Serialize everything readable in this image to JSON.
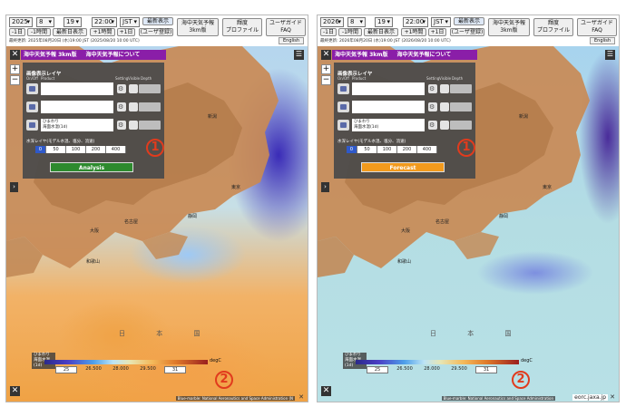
{
  "panels": [
    {
      "id": "left",
      "toolbar": {
        "year": "2025",
        "month": "8",
        "day": "19",
        "hour": "22:00",
        "tz": "JST",
        "latest_label": "最新表示",
        "back_day": "-1日",
        "back_hour": "-1時間",
        "latest_day": "最新日表示",
        "fwd_hour": "+1時間",
        "fwd_day": "+1日",
        "user_reg": "(ユーザ登録)",
        "forecast_title_1": "海中天気予報",
        "forecast_title_2": "3km版",
        "bright_1": "輝度",
        "bright_2": "プロファイル",
        "guide_1": "ユーザガイド",
        "guide_2": "FAQ",
        "info": "最終更新: 2025年08月20日 (水)19:00 JST (2025/08/20 10:00 UTC)",
        "english": "English"
      },
      "header": {
        "title": "海中天気予報 3km版",
        "link": "海中天気予報について"
      },
      "layer_panel": {
        "title": "画像表示レイヤ",
        "cols": [
          "On/Off",
          "Product",
          "Setting",
          "Visible",
          "Depth"
        ],
        "rows": [
          {
            "label": ""
          },
          {
            "label": ""
          },
          {
            "label": "ひまわり\n海面水温(1d)"
          }
        ],
        "depth_title": "水深レイヤ(モデル水温、塩分、流速)",
        "depths": [
          "0",
          "50",
          "100",
          "200",
          "400"
        ],
        "mode_button": "Analysis"
      },
      "circle_1": "1",
      "circle_2": "2",
      "places": {
        "niigata": "新潟",
        "tokyo": "東京",
        "osaka": "大阪",
        "nagoya": "名古屋",
        "shizuoka": "静岡",
        "wakayama": "和歌山"
      },
      "sea_label": "日 本 国",
      "legend": {
        "title": "ひまわり\n海面水温(1d)",
        "unit": "degC",
        "ticks": [
          "25",
          "26.500",
          "28.000",
          "29.500",
          "31"
        ]
      },
      "attrib": "Blue-marble: National Aeronautics and Space Administration (N",
      "close": "✕"
    },
    {
      "id": "right",
      "toolbar": {
        "year": "2026",
        "month": "8",
        "day": "19",
        "hour": "22:00",
        "tz": "JST",
        "latest_label": "最新表示",
        "back_day": "-1日",
        "back_hour": "-1時間",
        "latest_day": "最新日表示",
        "fwd_hour": "+1時間",
        "fwd_day": "+1日",
        "user_reg": "(ユーザ登録)",
        "forecast_title_1": "海中天気予報",
        "forecast_title_2": "3km版",
        "bright_1": "輝度",
        "bright_2": "プロファイル",
        "guide_1": "ユーザガイド",
        "guide_2": "FAQ",
        "info": "最終更新: 2026年08月20日 (水)19:00 JST (2026/08/20 10:00 UTC)",
        "english": "English"
      },
      "header": {
        "title": "海中天気予報 3km版",
        "link": "海中天気予報について"
      },
      "layer_panel": {
        "title": "画像表示レイヤ",
        "cols": [
          "On/Off",
          "Product",
          "Setting",
          "Visible",
          "Depth"
        ],
        "rows": [
          {
            "label": ""
          },
          {
            "label": ""
          },
          {
            "label": "ひまわり\n海面水温(1d)"
          }
        ],
        "depth_title": "水深レイヤ(モデル水温、塩分、流速)",
        "depths": [
          "0",
          "50",
          "100",
          "200",
          "400"
        ],
        "mode_button": "Forecast"
      },
      "circle_1": "1",
      "circle_2": "2",
      "places": {
        "niigata": "新潟",
        "tokyo": "東京",
        "osaka": "大阪",
        "nagoya": "名古屋",
        "shizuoka": "静岡",
        "wakayama": "和歌山"
      },
      "sea_label": "日 本 国",
      "legend": {
        "title": "ひまわり\n海面水温(1d)",
        "unit": "degC",
        "ticks": [
          "25",
          "26.500",
          "28.000",
          "29.500",
          "31"
        ]
      },
      "attrib": "Blue-marble: National Aeronautics and Space Administration",
      "url": "eorc.jaxa.jp",
      "close": "✕"
    }
  ]
}
